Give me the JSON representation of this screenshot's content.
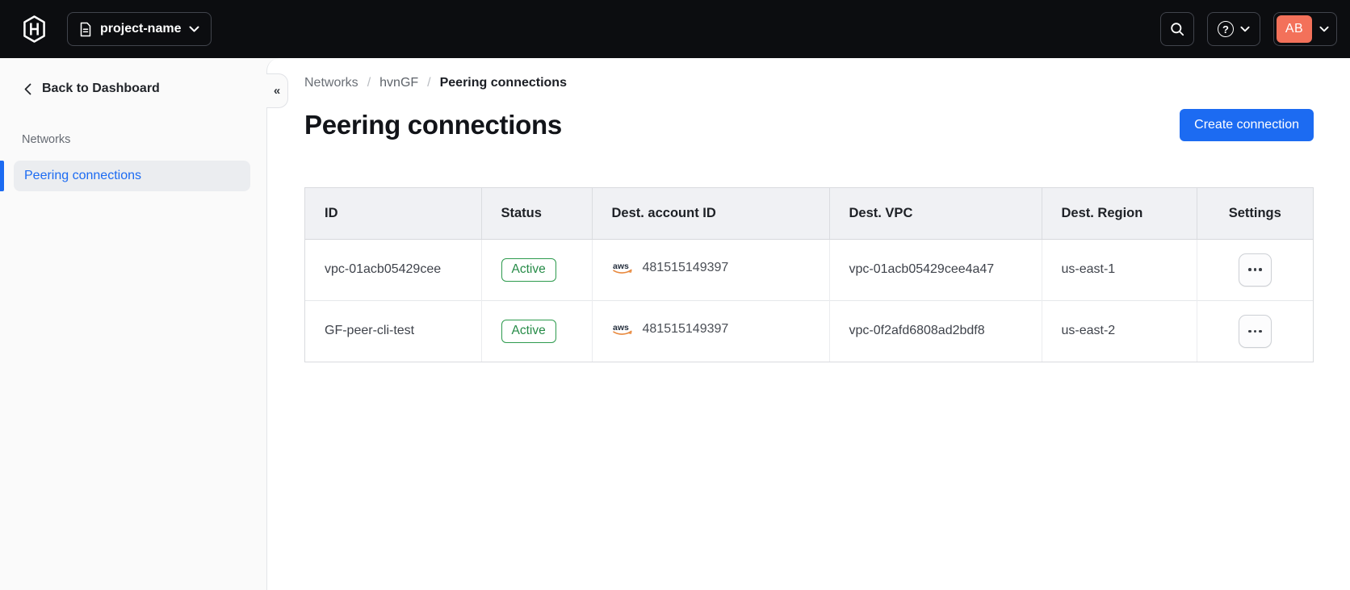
{
  "colors": {
    "topbar_bg": "#0C0D10",
    "accent_blue": "#1C6BF2",
    "success_green": "#2E9B4E",
    "avatar_orange": "#F3715A",
    "sidebar_bg": "#FAFAFA",
    "aws_smile_orange": "#E8883C"
  },
  "topbar": {
    "project_selector": {
      "label": "project-name"
    },
    "account": {
      "initials": "AB"
    }
  },
  "icons": {
    "help_glyph": "?",
    "collapse_glyph": "«"
  },
  "sidebar": {
    "back_button": "Back to Dashboard",
    "section_label": "Networks",
    "items": [
      {
        "label": "Peering connections",
        "active": true
      }
    ]
  },
  "breadcrumb": {
    "items": [
      "Networks",
      "hvnGF",
      "Peering connections"
    ],
    "separator": "/"
  },
  "page": {
    "title": "Peering connections",
    "create_button": "Create connection"
  },
  "table": {
    "columns": [
      "ID",
      "Status",
      "Dest. account ID",
      "Dest. VPC",
      "Dest. Region",
      "Settings"
    ],
    "rows": [
      {
        "id": "vpc-01acb05429cee",
        "status": "Active",
        "dest_account_id": "481515149397",
        "dest_vpc": "vpc-01acb05429cee4a47",
        "dest_region": "us-east-1"
      },
      {
        "id": "GF-peer-cli-test",
        "status": "Active",
        "dest_account_id": "481515149397",
        "dest_vpc": "vpc-0f2afd6808ad2bdf8",
        "dest_region": "us-east-2"
      }
    ]
  }
}
